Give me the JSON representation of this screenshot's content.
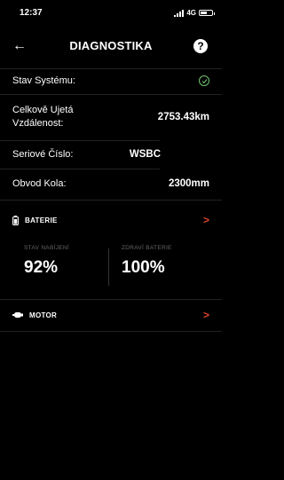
{
  "status": {
    "time": "12:37",
    "network": "4G"
  },
  "nav": {
    "title": "DIAGNOSTIKA",
    "back_icon": "arrow-left-icon",
    "help_label": "?"
  },
  "rows": [
    {
      "label": "Stav Systému:",
      "value": ""
    },
    {
      "label": "Celkově Ujetá Vzdálenost:",
      "value": "2753.43km"
    },
    {
      "label": "Seriové Číslo:",
      "value": "WSBC"
    },
    {
      "label": "Obvod Kola:",
      "value": "2300mm"
    }
  ],
  "battery": {
    "header": "BATERIE",
    "charge_label": "STAV NABÍJENÍ",
    "charge_value": "92%",
    "health_label": "ZDRAVÍ BATERIE",
    "health_value": "100%"
  },
  "motor": {
    "header": "MOTOR"
  },
  "colors": {
    "accent": "#e0432c",
    "ok": "#6fc36f",
    "background": "#000000"
  }
}
